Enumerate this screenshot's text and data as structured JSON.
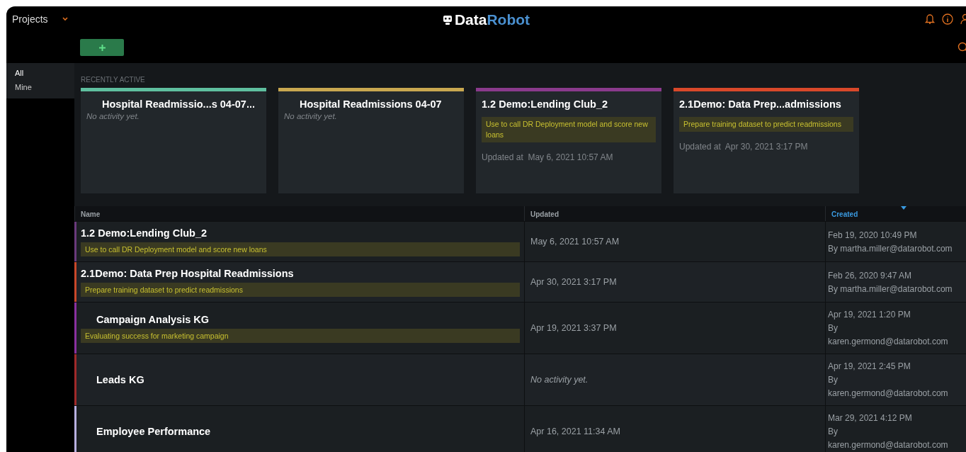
{
  "header": {
    "menu_label": "Projects",
    "logo": {
      "part_1": "Data",
      "part_2": "Robot"
    }
  },
  "sidebar": {
    "items": [
      {
        "label": "All",
        "selected": true
      },
      {
        "label": "Mine",
        "selected": false
      }
    ]
  },
  "recently_active": {
    "label": "RECENTLY ACTIVE",
    "cards": [
      {
        "title": "Hospital Readmissio...s 04-07...",
        "indented": true,
        "color": "#5fbf9f",
        "activity": "No activity yet."
      },
      {
        "title": "Hospital Readmissions 04-07",
        "indented": true,
        "color": "#c9a850",
        "activity": "No activity yet."
      },
      {
        "title": "1.2 Demo:Lending Club_2",
        "indented": false,
        "color": "#8a3a8c",
        "description": "Use to call DR Deployment model and score new loans",
        "updated_label": "Updated at",
        "updated": "May 6, 2021 10:57 AM"
      },
      {
        "title": "2.1Demo: Data Prep...admissions",
        "indented": false,
        "color": "#d9482a",
        "description": "Prepare training dataset to predict readmissions",
        "updated_label": "Updated at",
        "updated": "Apr 30, 2021 3:17 PM"
      }
    ]
  },
  "table": {
    "columns": [
      {
        "label": "Name",
        "selected": false
      },
      {
        "label": "Updated",
        "selected": false
      },
      {
        "label": "Created",
        "selected": true
      }
    ],
    "rows": [
      {
        "name": "1.2 Demo:Lending Club_2",
        "indented": false,
        "color": "#6a3a7c",
        "description": "Use to call DR Deployment model and score new loans",
        "updated": "May 6, 2021 10:57 AM",
        "created": "Feb 19, 2020 10:49 PM",
        "by": "By martha.miller@datarobot.com"
      },
      {
        "name": "2.1Demo: Data Prep Hospital Readmissions",
        "indented": false,
        "color": "#c9482a",
        "description": "Prepare training dataset to predict readmissions",
        "updated": "Apr 30, 2021 3:17 PM",
        "created": "Feb 26, 2020 9:47 AM",
        "by": "By martha.miller@datarobot.com"
      },
      {
        "name": "Campaign Analysis KG",
        "indented": true,
        "color": "#8a30a0",
        "description": "Evaluating success for marketing campaign",
        "updated": "Apr 19, 2021 3:37 PM",
        "created": "Apr 19, 2021 1:20 PM",
        "by": "By",
        "email": "karen.germond@datarobot.com"
      },
      {
        "name": "Leads KG",
        "indented": true,
        "color": "#a02a2a",
        "no_activity": "No activity yet.",
        "created": "Apr 19, 2021 2:45 PM",
        "by": "By",
        "email": "karen.germond@datarobot.com"
      },
      {
        "name": "Employee Performance",
        "indented": true,
        "color": "#b8b0e0",
        "updated": "Apr 16, 2021 11:34 AM",
        "created": "Mar 29, 2021 4:12 PM",
        "by": "By",
        "email": "karen.germond@datarobot.com"
      }
    ]
  }
}
